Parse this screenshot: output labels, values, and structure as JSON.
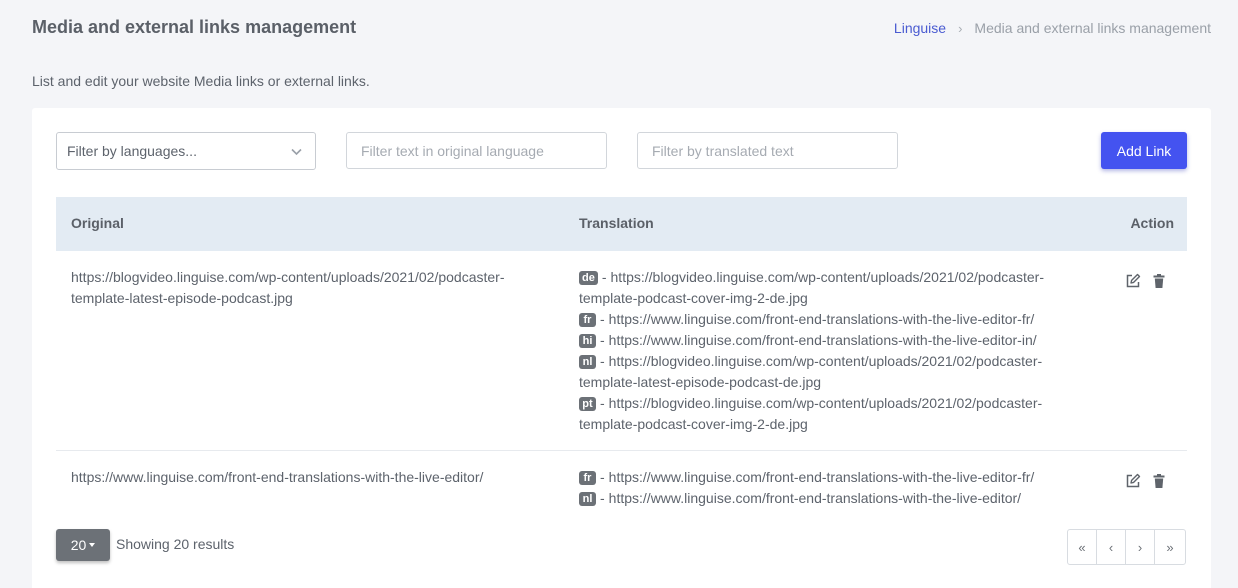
{
  "header": {
    "title": "Media and external links management",
    "breadcrumb": {
      "root": "Linguise",
      "separator": "›",
      "current": "Media and external links management"
    },
    "subtitle": "List and edit your website Media links or external links."
  },
  "filters": {
    "languages_placeholder": "Filter by languages...",
    "original_placeholder": "Filter text in original language",
    "translated_placeholder": "Filter by translated text",
    "add_button": "Add Link"
  },
  "table": {
    "columns": {
      "original": "Original",
      "translation": "Translation",
      "action": "Action"
    },
    "rows": [
      {
        "original": "https://blogvideo.linguise.com/wp-content/uploads/2021/02/podcaster-template-latest-episode-podcast.jpg",
        "translations": [
          {
            "lang": "de",
            "url": "https://blogvideo.linguise.com/wp-content/uploads/2021/02/podcaster-template-podcast-cover-img-2-de.jpg"
          },
          {
            "lang": "fr",
            "url": "https://www.linguise.com/front-end-translations-with-the-live-editor-fr/"
          },
          {
            "lang": "hi",
            "url": "https://www.linguise.com/front-end-translations-with-the-live-editor-in/"
          },
          {
            "lang": "nl",
            "url": "https://blogvideo.linguise.com/wp-content/uploads/2021/02/podcaster-template-latest-episode-podcast-de.jpg"
          },
          {
            "lang": "pt",
            "url": "https://blogvideo.linguise.com/wp-content/uploads/2021/02/podcaster-template-podcast-cover-img-2-de.jpg"
          }
        ]
      },
      {
        "original": "https://www.linguise.com/front-end-translations-with-the-live-editor/",
        "translations": [
          {
            "lang": "fr",
            "url": "https://www.linguise.com/front-end-translations-with-the-live-editor-fr/"
          },
          {
            "lang": "nl",
            "url": "https://www.linguise.com/front-end-translations-with-the-live-editor/"
          }
        ]
      }
    ],
    "dash": "-"
  },
  "footer": {
    "per_page": "20",
    "showing": "Showing 20 results",
    "pager": {
      "first": "«",
      "prev": "‹",
      "next": "›",
      "last": "»"
    }
  },
  "colors": {
    "accent": "#4453f0",
    "badge": "#6c7177",
    "table_header": "#e3ebf3",
    "link": "#4a5bd1"
  }
}
